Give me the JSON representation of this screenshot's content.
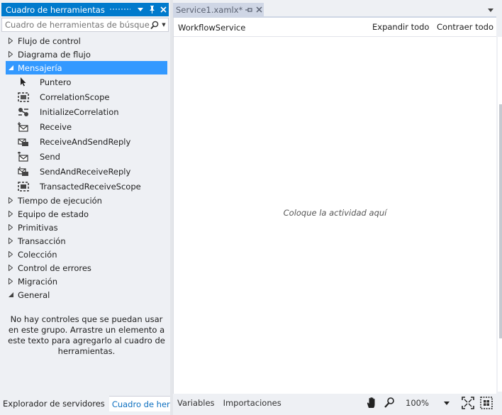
{
  "toolbox": {
    "title": "Cuadro de herramientas",
    "search_placeholder": "Cuadro de herramientas de búsqueda",
    "categories_before": [
      {
        "label": "Flujo de control",
        "expanded": false
      },
      {
        "label": "Diagrama de flujo",
        "expanded": false
      }
    ],
    "selected_category": {
      "label": "Mensajería",
      "expanded": true
    },
    "items": [
      {
        "label": "Puntero",
        "icon": "pointer-icon"
      },
      {
        "label": "CorrelationScope",
        "icon": "correlation-scope-icon"
      },
      {
        "label": "InitializeCorrelation",
        "icon": "initialize-correlation-icon"
      },
      {
        "label": "Receive",
        "icon": "receive-icon"
      },
      {
        "label": "ReceiveAndSendReply",
        "icon": "receive-and-send-reply-icon"
      },
      {
        "label": "Send",
        "icon": "send-icon"
      },
      {
        "label": "SendAndReceiveReply",
        "icon": "send-and-receive-reply-icon"
      },
      {
        "label": "TransactedReceiveScope",
        "icon": "transacted-receive-scope-icon"
      }
    ],
    "categories_after": [
      {
        "label": "Tiempo de ejecución",
        "expanded": false
      },
      {
        "label": "Equipo de estado",
        "expanded": false
      },
      {
        "label": "Primitivas",
        "expanded": false
      },
      {
        "label": "Transacción",
        "expanded": false
      },
      {
        "label": "Colección",
        "expanded": false
      },
      {
        "label": "Control de errores",
        "expanded": false
      },
      {
        "label": "Migración",
        "expanded": false
      },
      {
        "label": "General",
        "expanded": true
      }
    ],
    "empty_message": "No hay controles que se puedan usar en este grupo. Arrastre un elemento a este texto para agregarlo al cuadro de herramientas."
  },
  "left_tabs": {
    "server_explorer": "Explorador de servidores",
    "toolbox": "Cuadro de herr..."
  },
  "document": {
    "tab_title": "Service1.xamlx*",
    "breadcrumb": "WorkflowService",
    "expand_all": "Expandir todo",
    "collapse_all": "Contraer todo",
    "drop_hint": "Coloque la actividad aquí"
  },
  "bottom_bar": {
    "variables": "Variables",
    "imports": "Importaciones",
    "zoom": "100%"
  },
  "colors": {
    "accent": "#007acc",
    "selection": "#3399ff",
    "link": "#0e70c0"
  }
}
